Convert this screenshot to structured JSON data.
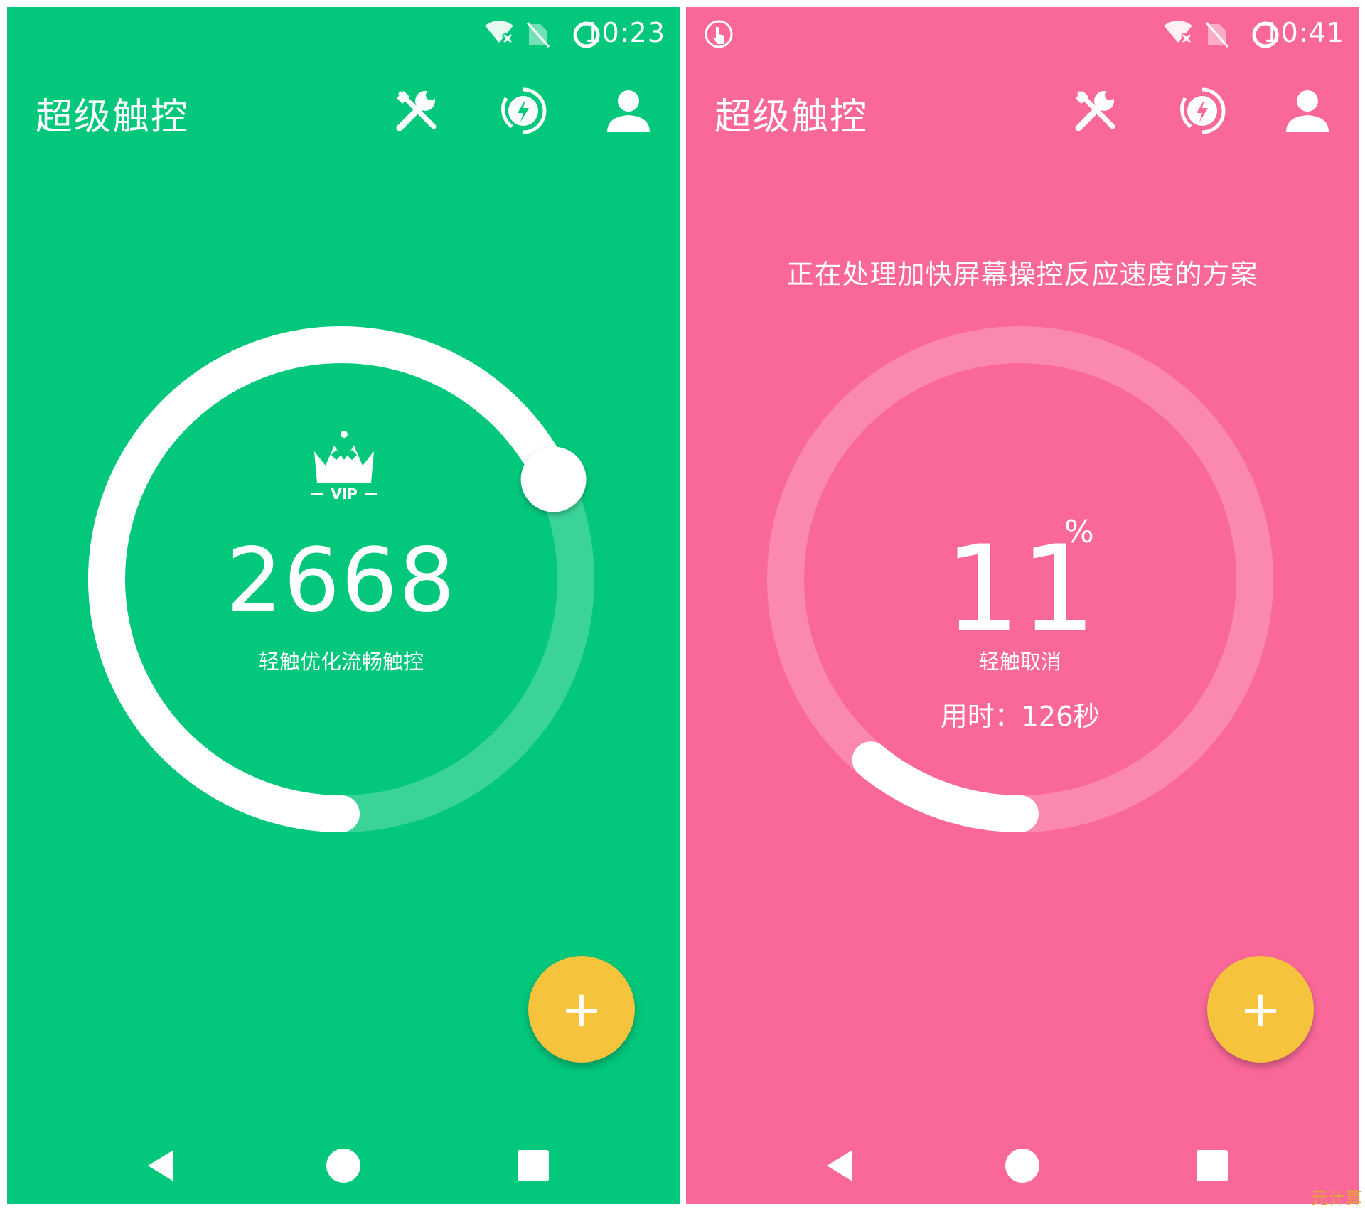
{
  "colors": {
    "green_bg": "#03c77b",
    "pink_bg": "#fa6899",
    "fab": "#f6c33c",
    "text": "#ffffff"
  },
  "left_screen": {
    "status": {
      "time": "10:23",
      "icons": [
        "wifi-x-icon",
        "no-sim-icon",
        "loading-ring-icon"
      ]
    },
    "app_title": "超级触控",
    "toolbar_icons": [
      "tools-icon",
      "boost-icon",
      "account-icon"
    ],
    "vip_badge": "VIP",
    "score": "2668",
    "score_caption": "轻触优化流畅触控",
    "progress_fraction": 0.68,
    "fab_label": "+"
  },
  "right_screen": {
    "status": {
      "time": "10:41",
      "icons": [
        "touch-icon",
        "wifi-x-icon",
        "no-sim-icon",
        "loading-ring-icon"
      ]
    },
    "app_title": "超级触控",
    "toolbar_icons": [
      "tools-icon",
      "boost-icon",
      "account-icon"
    ],
    "notice": "正在处理加快屏幕操控反应速度的方案",
    "percent_value": "11",
    "percent_sign": "%",
    "cancel_label": "轻触取消",
    "elapsed": "用时：126秒",
    "progress_fraction": 0.11,
    "fab_label": "+"
  },
  "nav_icons": [
    "back-icon",
    "home-icon",
    "recents-icon"
  ],
  "watermark": "元计算"
}
